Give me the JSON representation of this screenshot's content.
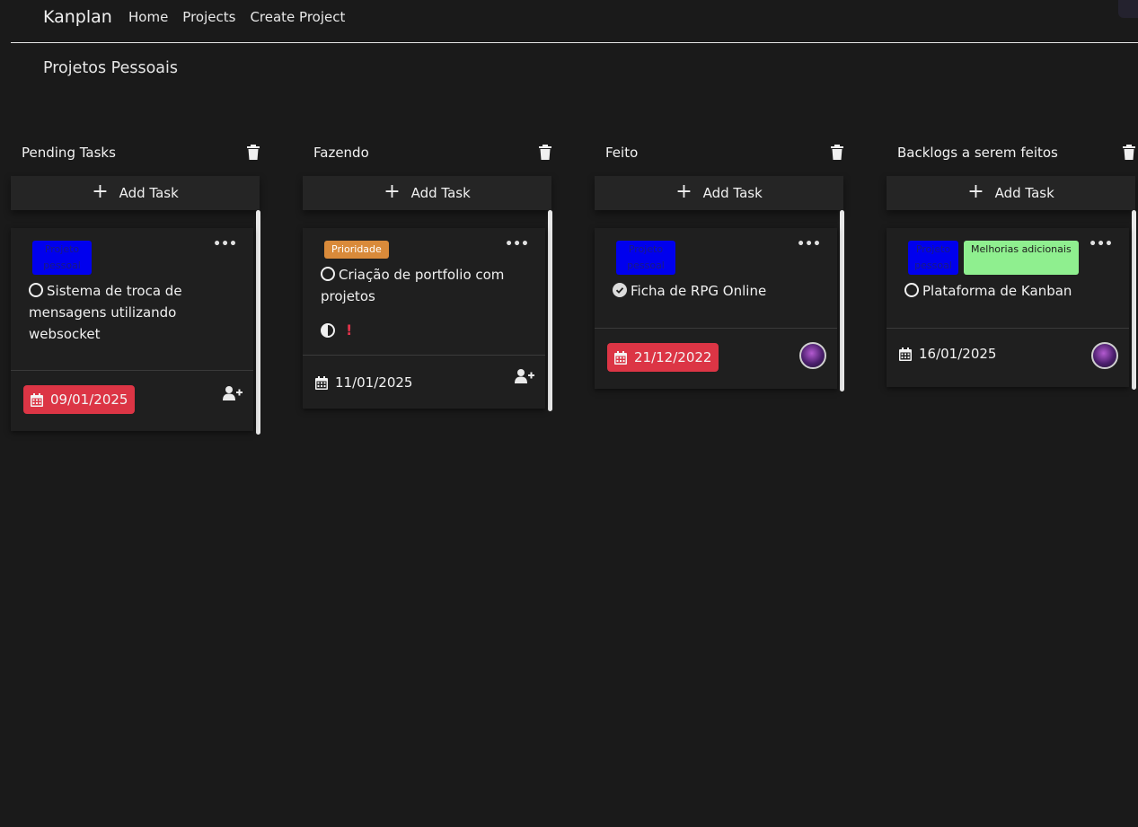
{
  "navbar": {
    "brand": "Kanplan",
    "links": [
      "Home",
      "Projects",
      "Create Project"
    ]
  },
  "page": {
    "title": "Projetos Pessoais"
  },
  "icons": {
    "column_delete": "trash-icon",
    "add": "plus-icon",
    "menu": "ellipsis-icon",
    "date": "calendar-icon",
    "assign": "user-plus-icon",
    "status_open": "circle-icon",
    "status_done": "check-circle-icon",
    "contrast": "half-circle-icon"
  },
  "colors": {
    "background": "#1a1a1a",
    "tag_blue": "#0000ee",
    "tag_green": "#8fef8f",
    "tag_orange": "#d98a3a",
    "date_red": "#dc3545"
  },
  "add_task_label": "Add Task",
  "menu_glyph": "•••",
  "columns": [
    {
      "title": "Pending Tasks",
      "card": {
        "tags": [
          "Projeto pessoal"
        ],
        "title": "Sistema de troca de mensagens utilizando websocket",
        "status": "open",
        "date": "09/01/2025"
      }
    },
    {
      "title": "Fazendo",
      "card": {
        "tags": [
          "Prioridade"
        ],
        "title": "Criação de portfolio com projetos",
        "status": "open",
        "priority_mark": "!",
        "date": "11/01/2025"
      }
    },
    {
      "title": "Feito",
      "card": {
        "tags": [
          "Projeto pessoal"
        ],
        "title": "Ficha de RPG Online",
        "status": "done",
        "date": "21/12/2022"
      }
    },
    {
      "title": "Backlogs a serem feitos",
      "card": {
        "tags": [
          "Projeto pessoal",
          "Melhorias adicionais"
        ],
        "title": "Plataforma de Kanban",
        "status": "open",
        "date": "16/01/2025"
      }
    }
  ]
}
